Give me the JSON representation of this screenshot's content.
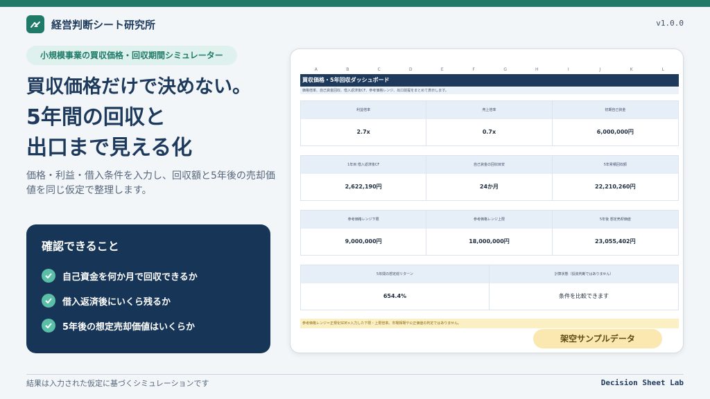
{
  "brand": {
    "name": "経営判断シート研究所",
    "version": "v1.0.0"
  },
  "pill": "小規模事業の買収価格・回収期間シミュレーター",
  "hero": {
    "line1": "買収価格だけで決めない。",
    "line2": "5年間の回収と",
    "line3": "出口まで見える化"
  },
  "description": "価格・利益・借入条件を入力し、回収額と5年後の売却価値を同じ仮定で整理します。",
  "card": {
    "title": "確認できること",
    "items": [
      "自己資金を何か月で回収できるか",
      "借入返済後にいくら残るか",
      "5年後の想定売却価値はいくらか"
    ]
  },
  "footer": {
    "left": "結果は入力された仮定に基づくシミュレーションです",
    "right": "Decision Sheet Lab"
  },
  "sheet": {
    "columns": [
      "A",
      "B",
      "C",
      "D",
      "E",
      "F",
      "G",
      "H",
      "I",
      "J",
      "K",
      "L"
    ],
    "title": "買収価格・5年回収ダッシュボード",
    "subtitle": "価格倍率、自己資金回収、借入返済後CF、参考価格レンジ、出口前提をまとめて表示します。",
    "row1": [
      {
        "label": "利益倍率",
        "value": "2.7x"
      },
      {
        "label": "売上倍率",
        "value": "0.7x"
      },
      {
        "label": "初期自己資金",
        "value": "6,000,000円"
      }
    ],
    "row2": [
      {
        "label": "1年目 借入返済後CF",
        "value": "2,622,190円"
      },
      {
        "label": "自己資金の回収目安",
        "value": "24か月"
      },
      {
        "label": "5年累積回収額",
        "value": "22,210,260円"
      }
    ],
    "row3": [
      {
        "label": "参考価格レンジ下限",
        "value": "9,000,000円"
      },
      {
        "label": "参考価格レンジ上限",
        "value": "18,000,000円"
      },
      {
        "label": "5年後 想定売却価値",
        "value": "23,055,402円"
      }
    ],
    "row4": [
      {
        "label": "5年間の想定総リターン",
        "value": "654.4%"
      },
      {
        "label": "計算状態（投資判断ではありません）",
        "value": "条件を比較できます"
      }
    ],
    "note": "参考価格レンジ＝正規化SDE×入力した下限・上限倍率。市場相場や公正価値の判定ではありません。",
    "stamp": "架空サンプルデータ"
  },
  "colors": {
    "accent": "#1f7a68",
    "navy": "#173657",
    "mint": "#5bbfa8"
  }
}
